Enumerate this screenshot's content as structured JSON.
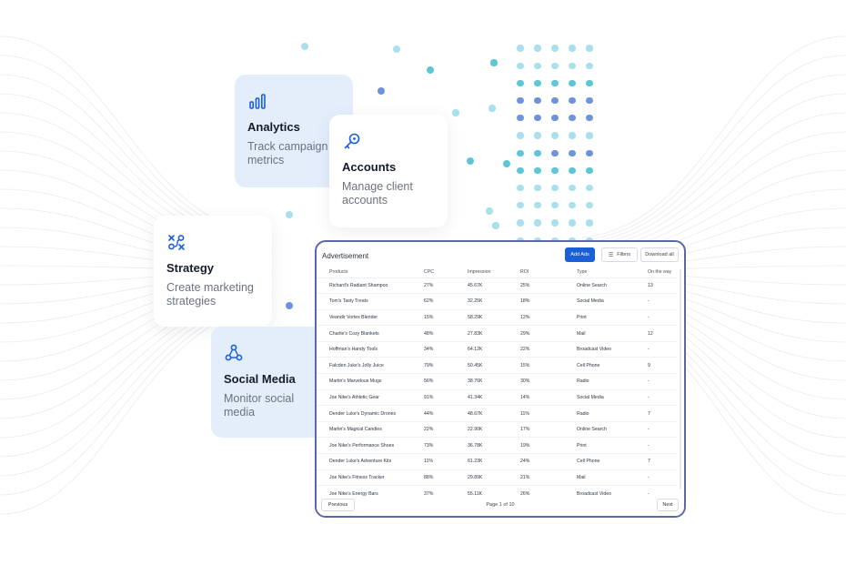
{
  "cards": {
    "analytics": {
      "title": "Analytics",
      "desc": "Track campaign metrics",
      "icon": "bar-chart-icon"
    },
    "accounts": {
      "title": "Accounts",
      "desc": "Manage client accounts",
      "icon": "key-icon"
    },
    "strategy": {
      "title": "Strategy",
      "desc": "Create marketing strategies",
      "icon": "strategy-icon"
    },
    "social": {
      "title": "Social Media",
      "desc": "Monitor social media",
      "icon": "social-network-icon"
    }
  },
  "table_panel": {
    "title": "Advertisement",
    "add_label": "Add Ads",
    "filters_label": "Filters",
    "download_label": "Download all",
    "columns": [
      "Products",
      "CPC",
      "Impression",
      "ROI",
      "Type",
      "On the way"
    ],
    "rows": [
      [
        "Richard's Radiant Shampoo",
        "27%",
        "45.67K",
        "25%",
        "Online Search",
        "13"
      ],
      [
        "Tom's Tasty Treats",
        "62%",
        "32.25K",
        "18%",
        "Social Media",
        "-"
      ],
      [
        "Veandir Vortex Blender",
        "15%",
        "58.29K",
        "12%",
        "Print",
        "-"
      ],
      [
        "Charlie's Cozy Blankets",
        "48%",
        "27.83K",
        "29%",
        "Mail",
        "12"
      ],
      [
        "Hoffman's Handy Tools",
        "34%",
        "64.12K",
        "22%",
        "Broadcast Video",
        "-"
      ],
      [
        "Falcden Juke's Jolly Juice",
        "79%",
        "50.45K",
        "15%",
        "Cell Phone",
        "9"
      ],
      [
        "Martin's Marvelous Mugs",
        "56%",
        "38.76K",
        "30%",
        "Radio",
        "-"
      ],
      [
        "Joe Nike's Athletic Gear",
        "91%",
        "41.34K",
        "14%",
        "Social Media",
        "-"
      ],
      [
        "Dender Luke's Dynamic Drones",
        "44%",
        "48.67K",
        "11%",
        "Radio",
        "7"
      ],
      [
        "Martin's Magical Candles",
        "22%",
        "22.90K",
        "17%",
        "Online Search",
        "-"
      ],
      [
        "Joe Nike's Performance Shoes",
        "73%",
        "36.78K",
        "19%",
        "Print",
        "-"
      ],
      [
        "Dender Luke's Adventure Kits",
        "11%",
        "61.23K",
        "24%",
        "Cell Phone",
        "7"
      ],
      [
        "Joe Nike's Fitness Tracker",
        "88%",
        "29.89K",
        "21%",
        "Mail",
        "-"
      ],
      [
        "Joe Nike's Energy Bars",
        "37%",
        "55.11K",
        "26%",
        "Broadcast Video",
        "-"
      ]
    ],
    "prev_label": "Previous",
    "next_label": "Next",
    "page_info": "Page 1 of 10"
  },
  "colors": {
    "accent": "#1b5fd6",
    "panel_border": "#5a67a8",
    "card_tint": "#e4eefb",
    "dot_light": "#a9e0ec",
    "dot_teal": "#5cc6d6",
    "dot_blue": "#6f93db"
  }
}
